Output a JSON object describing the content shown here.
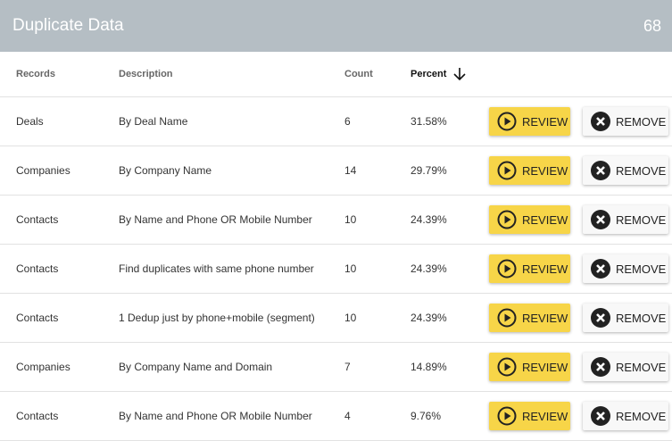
{
  "header": {
    "title": "Duplicate Data",
    "count": "68"
  },
  "columns": {
    "records": "Records",
    "description": "Description",
    "count": "Count",
    "percent": "Percent"
  },
  "sort": {
    "column": "Percent",
    "direction": "descending",
    "icon": "arrow-down-icon"
  },
  "buttons": {
    "review": "REVIEW",
    "remove": "REMOVE"
  },
  "colors": {
    "header_bg": "#b5bec4",
    "review_bg": "#f7d548",
    "remove_bg": "#f8f8f8"
  },
  "rows": [
    {
      "records": "Deals",
      "description": "By Deal Name",
      "count": "6",
      "percent": "31.58%"
    },
    {
      "records": "Companies",
      "description": "By Company Name",
      "count": "14",
      "percent": "29.79%"
    },
    {
      "records": "Contacts",
      "description": "By Name and Phone OR Mobile Number",
      "count": "10",
      "percent": "24.39%"
    },
    {
      "records": "Contacts",
      "description": "Find duplicates with same phone number",
      "count": "10",
      "percent": "24.39%"
    },
    {
      "records": "Contacts",
      "description": "1 Dedup just by phone+mobile (segment)",
      "count": "10",
      "percent": "24.39%"
    },
    {
      "records": "Companies",
      "description": "By Company Name and Domain",
      "count": "7",
      "percent": "14.89%"
    },
    {
      "records": "Contacts",
      "description": "By Name and Phone OR Mobile Number",
      "count": "4",
      "percent": "9.76%"
    }
  ]
}
